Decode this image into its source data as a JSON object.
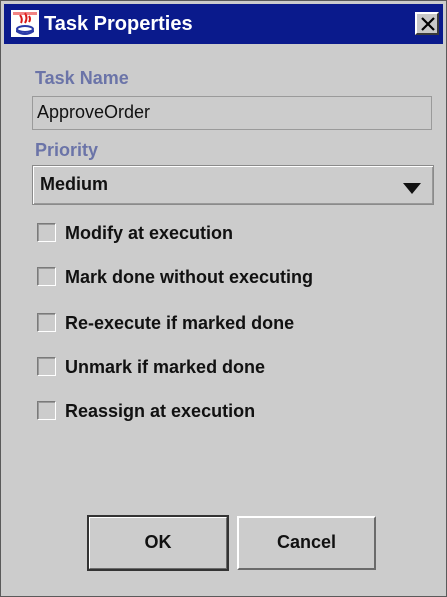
{
  "window": {
    "title": "Task Properties"
  },
  "form": {
    "task_name_label": "Task Name",
    "task_name_value": "ApproveOrder",
    "priority_label": "Priority",
    "priority_value": "Medium"
  },
  "options": [
    {
      "label": "Modify at execution",
      "checked": false
    },
    {
      "label": "Mark done without executing",
      "checked": false
    },
    {
      "label": "Re-execute if marked done",
      "checked": false
    },
    {
      "label": "Unmark if marked done",
      "checked": false
    },
    {
      "label": "Reassign at execution",
      "checked": false
    }
  ],
  "buttons": {
    "ok_label": "OK",
    "cancel_label": "Cancel"
  },
  "icons": {
    "title": "java-app-icon",
    "close": "close-icon",
    "dropdown": "triangle-down-icon"
  },
  "colors": {
    "titlebar": "#0a1a8c",
    "label": "#6b74a8",
    "background": "#cccccc"
  }
}
